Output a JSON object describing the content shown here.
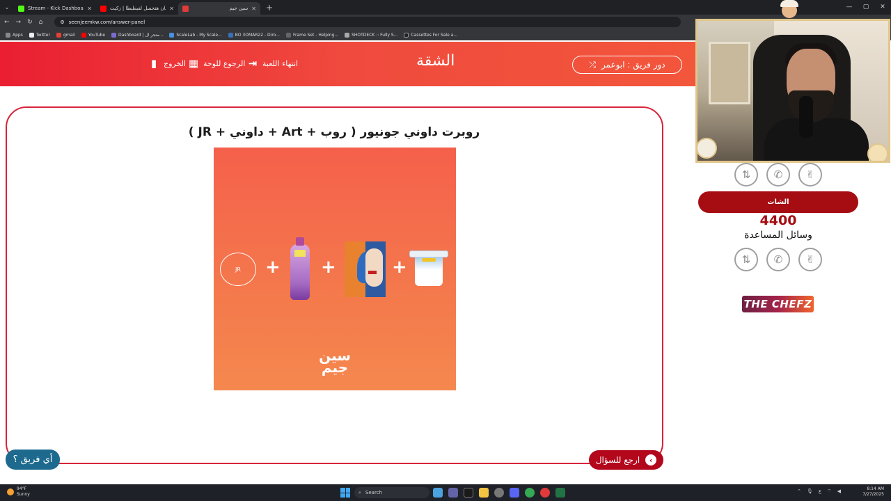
{
  "browser": {
    "tabs": [
      {
        "title": "Stream - Kick Dashboard",
        "color": "#53fc18",
        "active": false
      },
      {
        "title": "مهرجان هتحسل لفيطبطا | زكيت",
        "color": "#ff0000",
        "active": false
      },
      {
        "title": "سين جيم",
        "color": "#e23a3a",
        "active": true
      }
    ],
    "close_glyph": "✕",
    "new_tab_glyph": "+",
    "url": "seenjeemkw.com/answer-panel",
    "bookmarks": [
      "Apps",
      "Twitter",
      "gmail",
      "YouTube",
      "Dashboard | متجر ال...",
      "ScaleLab - My Scale...",
      "BO 3OMAR22 - Diro...",
      "Frame Set - Helping...",
      "SHOTDECK :: Fully S...",
      "Cassettes For Sale a..."
    ]
  },
  "header": {
    "exit_label": "الخروج",
    "board_label": "الرجوع للوحة",
    "end_game_label": "انتهاء اللعبة",
    "category_title": "الشقة",
    "team_turn_label": "دور فريق : ابوعمر"
  },
  "question": {
    "title": "روبرت داوني جونيور ( روب + Art + داوني + JR )",
    "jr_text": "JR",
    "plus_sign": "+",
    "logo_text": "سين جيم"
  },
  "buttons": {
    "back_to_question": "ارجع للسؤال",
    "which_team": "أي فريق ؟"
  },
  "side_panel": {
    "team_name": "الشات",
    "score": "4400",
    "aids_label": "وسائل المساعدة",
    "sponsor": "THE CHEFZ"
  },
  "taskbar": {
    "weather_temp": "94°F",
    "weather_desc": "Sunny",
    "search_label": "Search",
    "time": "8:14 AM",
    "date": "7/27/2025",
    "lang": "ع"
  },
  "colors": {
    "header_red": "#ea1f32",
    "card_border": "#d7243a",
    "team_red": "#a50d12",
    "which_team_blue": "#1e6a8f"
  }
}
